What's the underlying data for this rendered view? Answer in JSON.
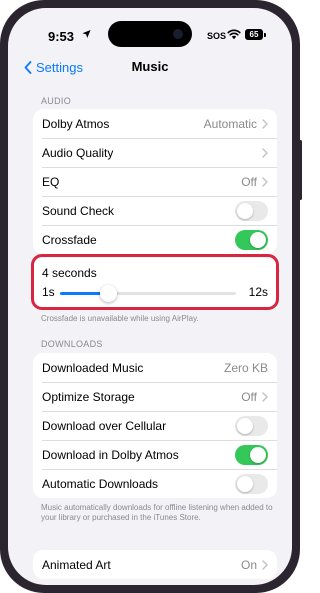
{
  "status_bar": {
    "time": "9:53",
    "sos": "SOS",
    "battery": "65"
  },
  "nav": {
    "back_label": "Settings",
    "title": "Music"
  },
  "audio": {
    "header": "AUDIO",
    "dolby_atmos": {
      "label": "Dolby Atmos",
      "value": "Automatic"
    },
    "audio_quality": {
      "label": "Audio Quality"
    },
    "eq": {
      "label": "EQ",
      "value": "Off"
    },
    "sound_check": {
      "label": "Sound Check",
      "on": false
    },
    "crossfade": {
      "label": "Crossfade",
      "on": true
    }
  },
  "crossfade_slider": {
    "value_label": "4 seconds",
    "min_label": "1s",
    "max_label": "12s",
    "min": 1,
    "max": 12,
    "value": 4
  },
  "crossfade_note": "Crossfade is unavailable while using AirPlay.",
  "downloads": {
    "header": "DOWNLOADS",
    "downloaded_music": {
      "label": "Downloaded Music",
      "value": "Zero KB"
    },
    "optimize_storage": {
      "label": "Optimize Storage",
      "value": "Off"
    },
    "download_cellular": {
      "label": "Download over Cellular",
      "on": false
    },
    "download_dolby": {
      "label": "Download in Dolby Atmos",
      "on": true
    },
    "automatic_downloads": {
      "label": "Automatic Downloads",
      "on": false
    }
  },
  "downloads_note": "Music automatically downloads for offline listening when added to your library or purchased in the iTunes Store.",
  "animated_art": {
    "label": "Animated Art",
    "value": "On"
  },
  "colors": {
    "accent": "#0a7aff",
    "toggle_on": "#34c759",
    "highlight": "#d82540",
    "background": "#f2f2f7"
  }
}
